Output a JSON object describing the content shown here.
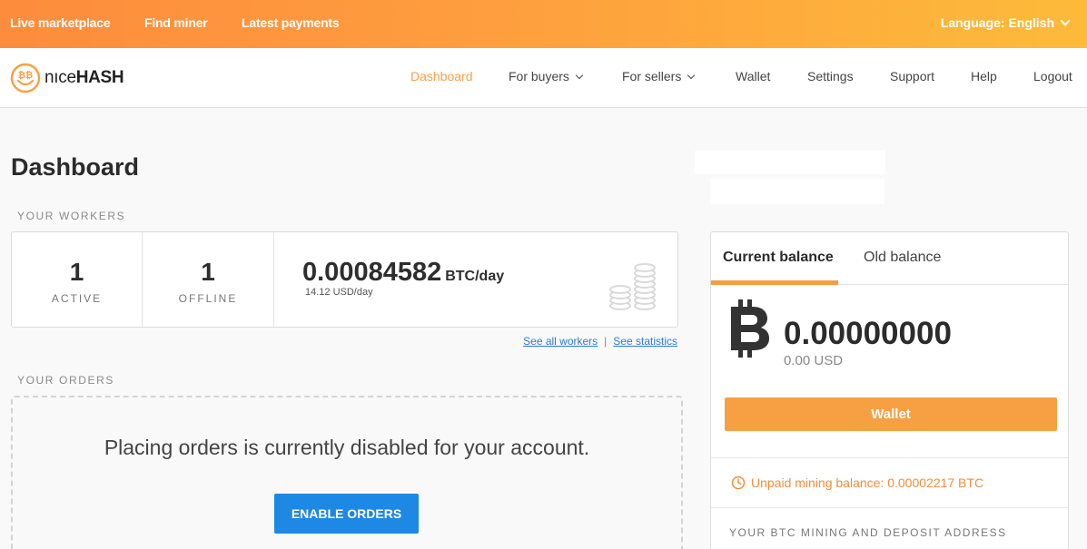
{
  "topbar": {
    "links": [
      "Live marketplace",
      "Find miner",
      "Latest payments"
    ],
    "language": "Language: English"
  },
  "brand": {
    "name_part1": "nıce",
    "name_part2": "HASH",
    "color": "#f7a043"
  },
  "nav": {
    "items": [
      "Dashboard",
      "For buyers",
      "For sellers",
      "Wallet",
      "Settings",
      "Support",
      "Help",
      "Logout"
    ],
    "active": "Dashboard"
  },
  "page": {
    "title": "Dashboard"
  },
  "workers": {
    "section_label": "YOUR WORKERS",
    "active_count": "1",
    "active_label": "ACTIVE",
    "offline_count": "1",
    "offline_label": "OFFLINE",
    "rate_value": "0.00084582",
    "rate_unit": "BTC/day",
    "rate_usd": "14.12 USD/day",
    "see_all": "See all workers",
    "separator": "|",
    "see_stats": "See statistics"
  },
  "orders": {
    "section_label": "YOUR ORDERS",
    "message": "Placing orders is currently disabled for your account.",
    "button": "ENABLE ORDERS"
  },
  "balance": {
    "tab_current": "Current balance",
    "tab_old": "Old balance",
    "btc_value": "0.00000000",
    "usd_value": "0.00 USD",
    "wallet_button": "Wallet",
    "unpaid": "Unpaid mining balance: 0.00002217 BTC",
    "address_label": "YOUR BTC MINING AND DEPOSIT ADDRESS"
  },
  "colors": {
    "accent": "#f7a043",
    "primary_button": "#1e88e5",
    "link": "#2a7bd5"
  }
}
